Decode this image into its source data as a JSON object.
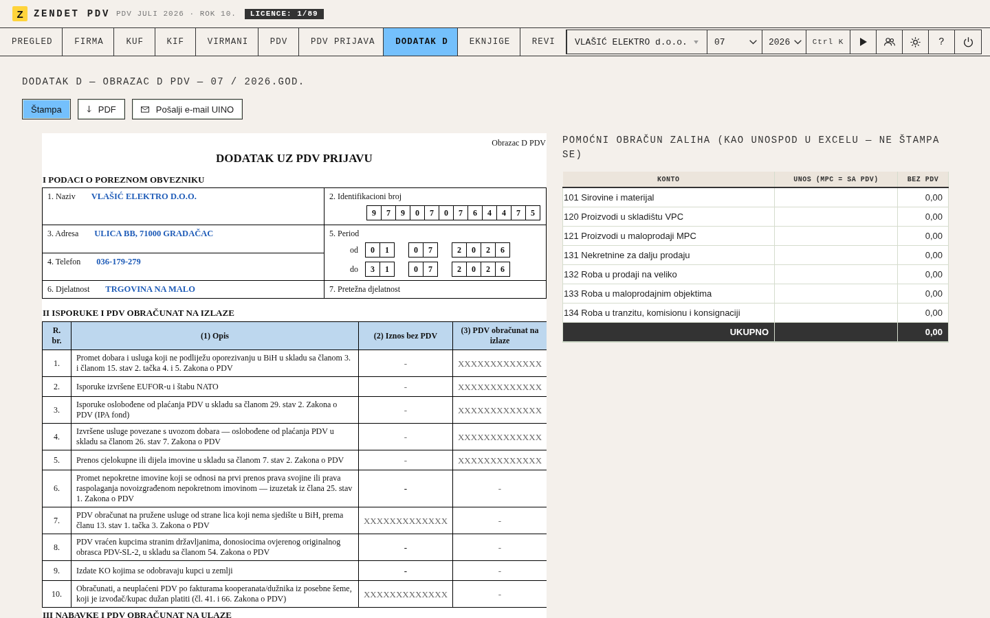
{
  "app": {
    "logo": "Z",
    "name": "ZENDET PDV",
    "subtitle": "PDV JULI 2026 · ROK 10.",
    "license": "LICENCE: 1/89"
  },
  "tabs": [
    {
      "label": "PREGLED",
      "selected": false
    },
    {
      "label": "FIRMA",
      "selected": false
    },
    {
      "label": "KUF",
      "selected": false
    },
    {
      "label": "KIF",
      "selected": false
    },
    {
      "label": "VIRMANI",
      "selected": false
    },
    {
      "label": "PDV",
      "selected": false
    },
    {
      "label": "PDV PRIJAVA",
      "selected": false
    },
    {
      "label": "DODATAK D",
      "selected": true
    },
    {
      "label": "EKNJIGE",
      "selected": false
    },
    {
      "label": "REVI",
      "selected": false
    }
  ],
  "toolbar": {
    "company": "VLAŠIĆ ELEKTRO d.o.o.",
    "month": "07",
    "year": "2026",
    "shortcut": "Ctrl K",
    "help": "?"
  },
  "page_title": "DODATAK D — OBRAZAC D PDV — 07 / 2026.GOD.",
  "actions": [
    {
      "label": "Štampa",
      "kind": "primary"
    },
    {
      "label": "PDF",
      "kind": "download"
    },
    {
      "label": "Pošalji e-mail UINO",
      "kind": "email"
    }
  ],
  "form": {
    "form_code": "Obrazac D PDV",
    "title": "DODATAK UZ PDV PRIJAVU",
    "taxpayer": {
      "heading": "I PODACI O POREZNOM OBVEZNIKU",
      "name": {
        "label": "1. Naziv",
        "value": "VLAŠIĆ ELEKTRO D.O.O."
      },
      "tax_id": {
        "label": "2. Identifikacioni broj",
        "digits": [
          "9",
          "7",
          "9",
          "0",
          "7",
          "0",
          "7",
          "6",
          "4",
          "4",
          "7",
          "5"
        ]
      },
      "address": {
        "label": "3. Adresa",
        "value": "ULICA BB, 71000 GRADAČAC"
      },
      "phone": {
        "label": "4. Telefon",
        "value": "036-179-279"
      },
      "period": {
        "label": "5. Period",
        "rows": [
          {
            "label": "od",
            "groups": [
              [
                "0",
                "1"
              ],
              [
                "0",
                "7"
              ],
              [
                "2",
                "0",
                "2",
                "6"
              ]
            ]
          },
          {
            "label": "do",
            "groups": [
              [
                "3",
                "1"
              ],
              [
                "0",
                "7"
              ],
              [
                "2",
                "0",
                "2",
                "6"
              ]
            ]
          }
        ]
      },
      "activity": {
        "label": "6. Djelatnost",
        "value": "TRGOVINA NA MALO"
      },
      "main_activity": {
        "label": "7. Pretežna djelatnost"
      }
    },
    "supplies": {
      "heading": "II ISPORUKE I PDV OBRAČUNAT NA IZLAZE",
      "columns": [
        "R. br.",
        "(1) Opis",
        "(2) Iznos bez PDV",
        "(3) PDV obračunat na izlaze"
      ],
      "rows": [
        {
          "number": "1.",
          "description": "Promet dobara i usluga koji ne podliježu oporezivanju u BiH u skladu sa članom 3. i članom 15. stav 2. tačka 4. i 5. Zakona o PDV",
          "cells": [
            {
              "text": "-",
              "bold": false
            },
            {
              "text": "XXXXXXXXXXXXX",
              "bold": false
            }
          ]
        },
        {
          "number": "2.",
          "description": "Isporuke izvršene EUFOR-u i štabu NATO",
          "cells": [
            {
              "text": "-",
              "bold": false
            },
            {
              "text": "XXXXXXXXXXXXX",
              "bold": false
            }
          ]
        },
        {
          "number": "3.",
          "description": "Isporuke oslobođene od plaćanja PDV u skladu sa članom 29. stav 2. Zakona o PDV (IPA fond)",
          "cells": [
            {
              "text": "-",
              "bold": false
            },
            {
              "text": "XXXXXXXXXXXXX",
              "bold": false
            }
          ]
        },
        {
          "number": "4.",
          "description": "Izvršene usluge povezane s uvozom dobara — oslobođene od plaćanja PDV u skladu sa članom 26. stav 7. Zakona o PDV",
          "cells": [
            {
              "text": "-",
              "bold": false
            },
            {
              "text": "XXXXXXXXXXXXX",
              "bold": false
            }
          ]
        },
        {
          "number": "5.",
          "description": "Prenos cjelokupne ili dijela imovine u skladu sa članom 7. stav 2. Zakona o PDV",
          "cells": [
            {
              "text": "-",
              "bold": false
            },
            {
              "text": "XXXXXXXXXXXXX",
              "bold": false
            }
          ]
        },
        {
          "number": "6.",
          "description": "Promet nepokretne imovine koji se odnosi na prvi prenos prava svojine ili prava raspolaganja novoizgrađenom nepokretnom imovinom — izuzetak iz člana 25. stav 1. Zakona o PDV",
          "cells": [
            {
              "text": "-",
              "bold": true
            },
            {
              "text": "-",
              "bold": false
            }
          ]
        },
        {
          "number": "7.",
          "description": "PDV obračunat na pružene usluge od strane lica koji nema sjedište u BiH, prema članu 13. stav 1. tačka 3. Zakona o PDV",
          "cells": [
            {
              "text": "XXXXXXXXXXXXX",
              "bold": false
            },
            {
              "text": "-",
              "bold": false
            }
          ]
        },
        {
          "number": "8.",
          "description": "PDV vraćen kupcima stranim državljanima, donosiocima ovjerenog originalnog obrasca PDV-SL-2, u skladu sa članom 54. Zakona o PDV",
          "cells": [
            {
              "text": "-",
              "bold": true
            },
            {
              "text": "-",
              "bold": false
            }
          ]
        },
        {
          "number": "9.",
          "description": "Izdate KO kojima se odobravaju kupci u zemlji",
          "cells": [
            {
              "text": "-",
              "bold": true
            },
            {
              "text": "-",
              "bold": false
            }
          ]
        },
        {
          "number": "10.",
          "description": "Obračunati, a neuplaćeni PDV po fakturama kooperanata/dužnika iz posebne šeme, koji je izvođač/kupac dužan platiti (čl. 41. i 66. Zakona o PDV)",
          "cells": [
            {
              "text": "XXXXXXXXXXXXX",
              "bold": false
            },
            {
              "text": "-",
              "bold": false
            }
          ]
        }
      ]
    },
    "purchases": {
      "heading": "III NABAVKE I PDV OBRAČUNAT NA ULAZE"
    }
  },
  "stock_panel": {
    "title": "POMOĆNI OBRAČUN ZALIHA (KAO UNOSPOD U EXCELU — NE ŠTAMPA SE)",
    "columns": [
      "KONTO",
      "UNOS (MPC = SA PDV)",
      "BEZ PDV"
    ],
    "rows": [
      {
        "konto": "101 Sirovine i materijal",
        "amount": "0,00"
      },
      {
        "konto": "120 Proizvodi u skladištu VPC",
        "amount": "0,00"
      },
      {
        "konto": "121 Proizvodi u maloprodaji MPC",
        "amount": "0,00"
      },
      {
        "konto": "131 Nekretnine za dalju prodaju",
        "amount": "0,00"
      },
      {
        "konto": "132 Roba u prodaji na veliko",
        "amount": "0,00"
      },
      {
        "konto": "133 Roba u maloprodajnim objektima",
        "amount": "0,00"
      },
      {
        "konto": "134 Roba u tranzitu, komisionu i konsignaciji",
        "amount": "0,00"
      }
    ],
    "total": {
      "label": "UKUPNO",
      "amount": "0,00"
    }
  }
}
